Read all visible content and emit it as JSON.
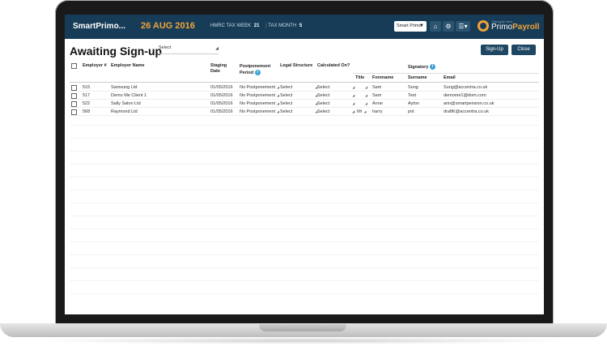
{
  "topbar": {
    "brand": "SmartPrimo...",
    "date": "26 AUG 2016",
    "tax_week_label": "HMRC TAX WEEK",
    "tax_week_value": "21",
    "tax_month_label": "TAX MONTH",
    "tax_month_value": "5",
    "company_select": "Smart Primo",
    "logo_small": "Smartprimo",
    "logo_name_primo": "Primo",
    "logo_name_payroll": "Payroll"
  },
  "page": {
    "title": "Awaiting Sign-up",
    "filter_select": "Select",
    "signup_button": "Sign-Up",
    "close_button": "Close"
  },
  "columns": {
    "employer_no": "Employer #",
    "employer_name": "Employer Name",
    "staging_date_1": "Staging",
    "staging_date_2": "Date",
    "postponement_1": "Postponement",
    "postponement_2": "Period",
    "legal_structure": "Legal Structure",
    "calculated_on": "Calculated On?",
    "signatory": "Signatory",
    "title": "Title",
    "forename": "Forename",
    "surname": "Surname",
    "email": "Email"
  },
  "rows": [
    {
      "employer_no": "515",
      "employer_name": "Samsung Ltd",
      "staging_date": "01/05/2016",
      "postponement": "No Postponement",
      "legal_structure": "Select",
      "calculated_on": "Select",
      "title": "",
      "forename": "Sam",
      "surname": "Sung",
      "email": "Sung@accentra.co.uk"
    },
    {
      "employer_no": "517",
      "employer_name": "Demo Me Client 1",
      "staging_date": "01/05/2016",
      "postponement": "No Postponement",
      "legal_structure": "Select",
      "calculated_on": "Select",
      "title": "",
      "forename": "Sam",
      "surname": "Test",
      "email": "demome1@dom.com"
    },
    {
      "employer_no": "522",
      "employer_name": "Sally Salon Ltd",
      "staging_date": "01/05/2016",
      "postponement": "No Postponement",
      "legal_structure": "Select",
      "calculated_on": "Select",
      "title": "",
      "forename": "Anne",
      "surname": "Ayton",
      "email": "ann@smartpension.co.uk"
    },
    {
      "employer_no": "568",
      "employer_name": "Raymond Ltd",
      "staging_date": "01/05/2016",
      "postponement": "No Postponement",
      "legal_structure": "Select",
      "calculated_on": "Select",
      "title": "Mr",
      "forename": "harry",
      "surname": "pot",
      "email": "draftK@accentra.co.uk"
    }
  ]
}
